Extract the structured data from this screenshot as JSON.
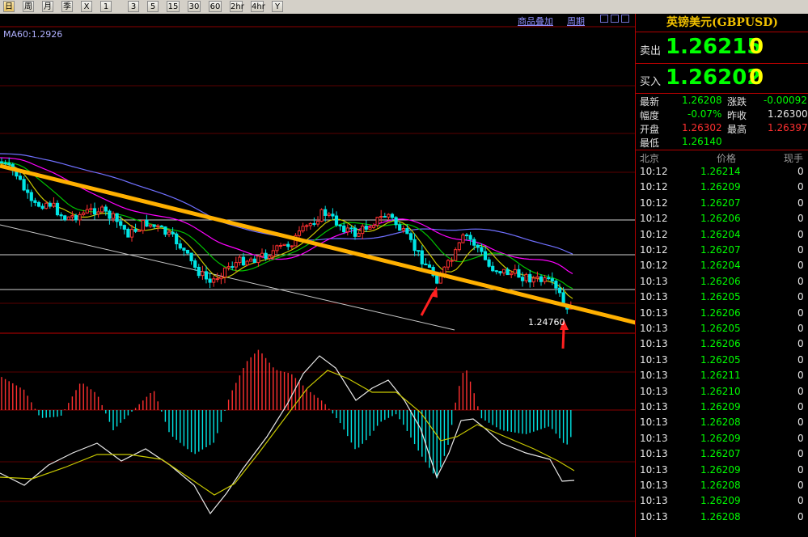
{
  "toolbar": {
    "buttons": [
      "日",
      "周",
      "月",
      "季",
      "X",
      "1",
      "3",
      "5",
      "15",
      "30",
      "60",
      "2hr",
      "4hr",
      "Y"
    ]
  },
  "chart": {
    "ma_label": "MA60:1.2926",
    "tab_overlay": "商品叠加",
    "tab_period": "周期",
    "low_label": "1.24760"
  },
  "quote": {
    "title": "英镑美元(GBPUSD)",
    "sell_label": "卖出",
    "sell_price": "1.26215",
    "sell_vol": "0",
    "buy_label": "买入",
    "buy_price": "1.26202",
    "buy_vol": "0",
    "stats": {
      "latest_label": "最新",
      "latest": "1.26208",
      "change_label": "涨跌",
      "change": "-0.00092",
      "range_label": "幅度",
      "range": "-0.07%",
      "prevclose_label": "昨收",
      "prevclose": "1.26300",
      "open_label": "开盘",
      "open": "1.26302",
      "high_label": "最高",
      "high": "1.26397",
      "low_label": "最低",
      "low": "1.26140"
    },
    "ticks_header": {
      "time": "北京",
      "price": "价格",
      "vol": "现手"
    },
    "ticks": [
      {
        "t": "10:12",
        "p": "1.26214",
        "v": "0"
      },
      {
        "t": "10:12",
        "p": "1.26209",
        "v": "0"
      },
      {
        "t": "10:12",
        "p": "1.26207",
        "v": "0"
      },
      {
        "t": "10:12",
        "p": "1.26206",
        "v": "0"
      },
      {
        "t": "10:12",
        "p": "1.26204",
        "v": "0"
      },
      {
        "t": "10:12",
        "p": "1.26207",
        "v": "0"
      },
      {
        "t": "10:12",
        "p": "1.26204",
        "v": "0"
      },
      {
        "t": "10:13",
        "p": "1.26206",
        "v": "0"
      },
      {
        "t": "10:13",
        "p": "1.26205",
        "v": "0"
      },
      {
        "t": "10:13",
        "p": "1.26206",
        "v": "0"
      },
      {
        "t": "10:13",
        "p": "1.26205",
        "v": "0"
      },
      {
        "t": "10:13",
        "p": "1.26206",
        "v": "0"
      },
      {
        "t": "10:13",
        "p": "1.26205",
        "v": "0"
      },
      {
        "t": "10:13",
        "p": "1.26211",
        "v": "0"
      },
      {
        "t": "10:13",
        "p": "1.26210",
        "v": "0"
      },
      {
        "t": "10:13",
        "p": "1.26209",
        "v": "0"
      },
      {
        "t": "10:13",
        "p": "1.26208",
        "v": "0"
      },
      {
        "t": "10:13",
        "p": "1.26209",
        "v": "0"
      },
      {
        "t": "10:13",
        "p": "1.26207",
        "v": "0"
      },
      {
        "t": "10:13",
        "p": "1.26209",
        "v": "0"
      },
      {
        "t": "10:13",
        "p": "1.26208",
        "v": "0"
      },
      {
        "t": "10:13",
        "p": "1.26209",
        "v": "0"
      },
      {
        "t": "10:13",
        "p": "1.26208",
        "v": "0"
      }
    ]
  },
  "colors": {
    "up_candle": "#ff3030",
    "down_candle": "#00e5e5",
    "trendline": "#ffb000",
    "ma_purple": "#7070ff",
    "ma_magenta": "#ff00ff",
    "ma_green": "#00c000",
    "ma_yellow": "#c8c800",
    "price_green": "#00ff00"
  }
}
